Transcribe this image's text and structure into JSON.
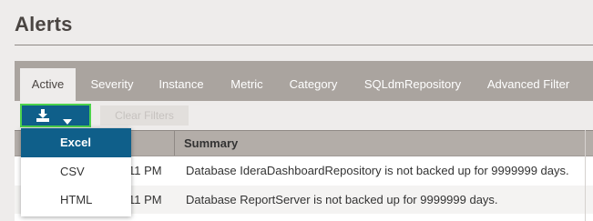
{
  "page": {
    "title": "Alerts"
  },
  "tabs": [
    {
      "label": "Active",
      "active": true
    },
    {
      "label": "Severity"
    },
    {
      "label": "Instance"
    },
    {
      "label": "Metric"
    },
    {
      "label": "Category"
    },
    {
      "label": "SQLdmRepository"
    },
    {
      "label": "Advanced Filter"
    }
  ],
  "toolbar": {
    "export_icon": "download-icon",
    "export_caret": "caret-down-icon",
    "clear_filters_label": "Clear Filters"
  },
  "export_menu": {
    "items": [
      {
        "label": "Excel",
        "selected": true
      },
      {
        "label": "CSV"
      },
      {
        "label": "HTML"
      }
    ]
  },
  "grid": {
    "columns": [
      "Summary"
    ],
    "rows": [
      {
        "time": "11 PM",
        "summary": "Database IderaDashboardRepository is not backed up for 9999999 days."
      },
      {
        "time": "11 PM",
        "summary": "Database ReportServer is not backed up for 9999999 days."
      }
    ]
  },
  "colors": {
    "accent_blue": "#0f5f8a",
    "focus_green": "#4cd24c",
    "tabbar": "#aaa49f"
  }
}
